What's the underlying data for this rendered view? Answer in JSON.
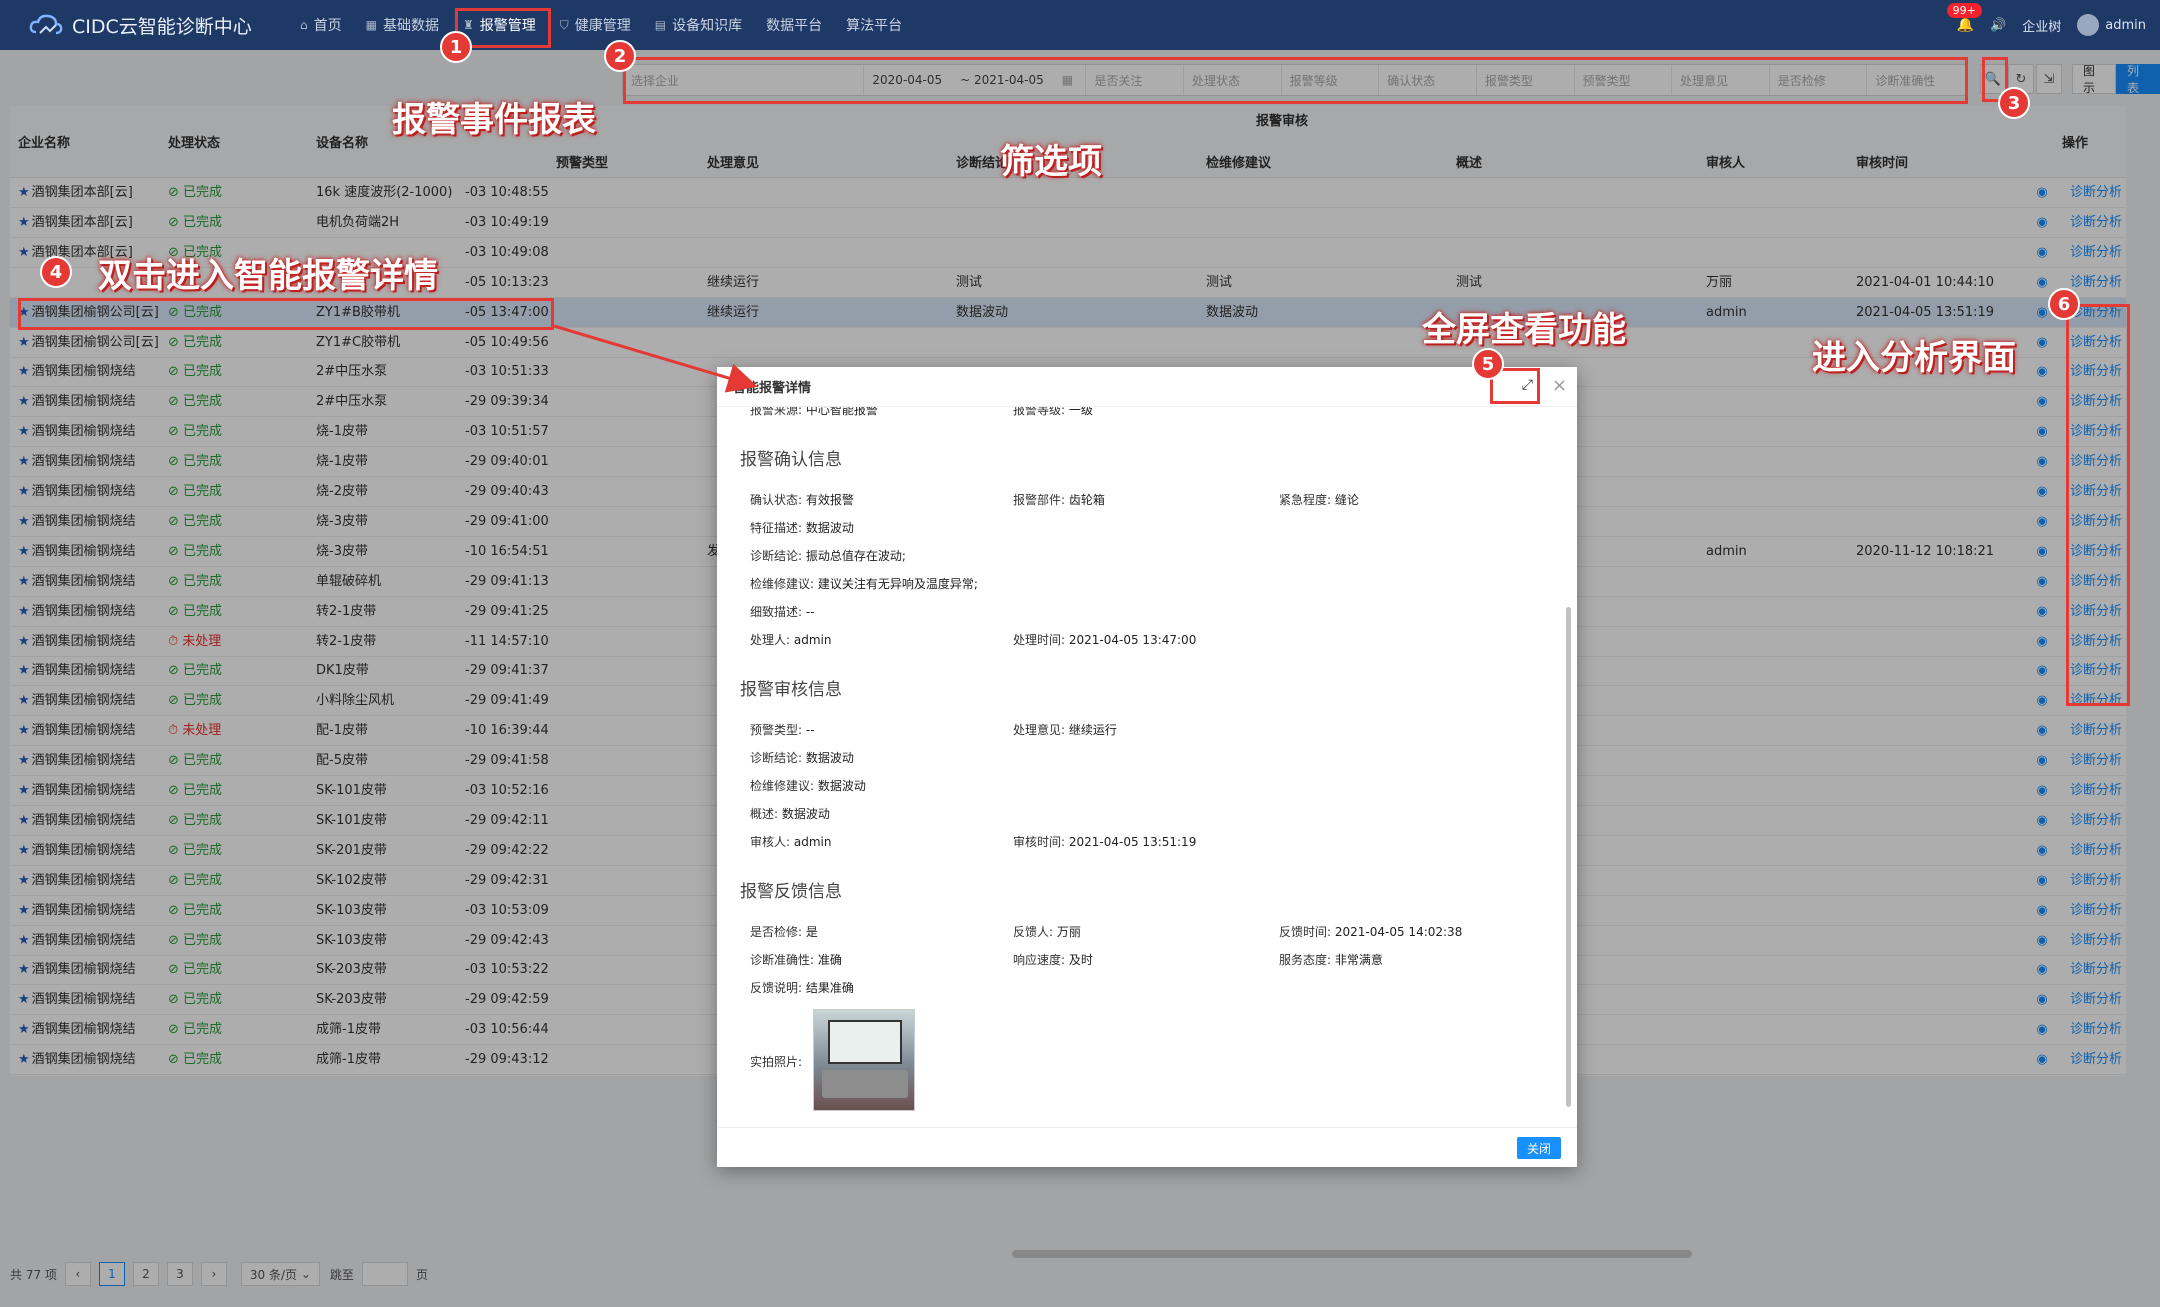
{
  "app": {
    "title": "CIDC云智能诊断中心"
  },
  "nav": [
    {
      "icon": "home-icon",
      "glyph": "⌂",
      "label": "首页",
      "active": false
    },
    {
      "icon": "grid-icon",
      "glyph": "▦",
      "label": "基础数据",
      "active": false
    },
    {
      "icon": "alarm-icon",
      "glyph": "♜",
      "label": "报警管理",
      "active": true
    },
    {
      "icon": "shield-icon",
      "glyph": "⛉",
      "label": "健康管理",
      "active": false
    },
    {
      "icon": "book-icon",
      "glyph": "▤",
      "label": "设备知识库",
      "active": false
    },
    {
      "label": "数据平台",
      "active": false
    },
    {
      "label": "算法平台",
      "active": false
    }
  ],
  "topright": {
    "badge": "99+",
    "enterprise": "企业树",
    "user": "admin"
  },
  "filters": {
    "company": "选择企业",
    "date_start": "2020-04-05",
    "date_end": "~ 2021-04-05",
    "f1": "是否关注",
    "f2": "处理状态",
    "f3": "报警等级",
    "f4": "确认状态",
    "f5": "报警类型",
    "f6": "预警类型",
    "f7": "处理意见",
    "f8": "是否检修",
    "f9": "诊断准确性"
  },
  "views": {
    "chart": "图示",
    "list": "列表"
  },
  "table": {
    "group_header": "报警审核",
    "headers": {
      "company": "企业名称",
      "status": "处理状态",
      "device": "设备名称",
      "warn_type": "预警类型",
      "opinion": "处理意见",
      "diag": "诊断结论",
      "repair": "检维修建议",
      "desc": "概述",
      "auditor": "审核人",
      "audit_time": "审核时间",
      "ops": "操作"
    },
    "link_label": "诊断分析",
    "rows": [
      {
        "company": "酒钢集团本部[云]",
        "status": "已完成",
        "ok": true,
        "device": "16k 速度波形(2-1000)",
        "time": "-03 10:48:55",
        "opinion": "",
        "diag": "",
        "repair": "",
        "desc": "",
        "auditor": "",
        "atime": ""
      },
      {
        "company": "酒钢集团本部[云]",
        "status": "已完成",
        "ok": true,
        "device": "电机负荷端2H",
        "time": "-03 10:49:19",
        "opinion": "",
        "diag": "",
        "repair": "",
        "desc": "",
        "auditor": "",
        "atime": ""
      },
      {
        "company": "酒钢集团本部[云]",
        "status": "已完成",
        "ok": true,
        "device": "",
        "time": "-03 10:49:08",
        "opinion": "",
        "diag": "",
        "repair": "",
        "desc": "",
        "auditor": "",
        "atime": ""
      },
      {
        "company": "",
        "status": "",
        "ok": true,
        "device": "",
        "time": "-05 10:13:23",
        "opinion": "继续运行",
        "diag": "测试",
        "repair": "测试",
        "desc": "测试",
        "auditor": "万丽",
        "atime": "2021-04-01 10:44:10"
      },
      {
        "company": "酒钢集团榆钢公司[云]",
        "status": "已完成",
        "ok": true,
        "device": "ZY1#B胶带机",
        "time": "-05 13:47:00",
        "opinion": "继续运行",
        "diag": "数据波动",
        "repair": "数据波动",
        "desc": "",
        "auditor": "admin",
        "atime": "2021-04-05 13:51:19",
        "selected": true
      },
      {
        "company": "酒钢集团榆钢公司[云]",
        "status": "已完成",
        "ok": true,
        "device": "ZY1#C胶带机",
        "time": "-05 10:49:56",
        "opinion": "",
        "diag": "",
        "repair": "",
        "desc": "",
        "auditor": "",
        "atime": ""
      },
      {
        "company": "酒钢集团榆钢烧结",
        "status": "已完成",
        "ok": true,
        "device": "2#中压水泵",
        "time": "-03 10:51:33",
        "opinion": "",
        "diag": "",
        "repair": "",
        "desc": "",
        "auditor": "",
        "atime": ""
      },
      {
        "company": "酒钢集团榆钢烧结",
        "status": "已完成",
        "ok": true,
        "device": "2#中压水泵",
        "time": "-29 09:39:34",
        "opinion": "",
        "diag": "",
        "repair": "",
        "desc": "",
        "auditor": "",
        "atime": ""
      },
      {
        "company": "酒钢集团榆钢烧结",
        "status": "已完成",
        "ok": true,
        "device": "烧-1皮带",
        "time": "-03 10:51:57",
        "opinion": "",
        "diag": "",
        "repair": "",
        "desc": "",
        "auditor": "",
        "atime": ""
      },
      {
        "company": "酒钢集团榆钢烧结",
        "status": "已完成",
        "ok": true,
        "device": "烧-1皮带",
        "time": "-29 09:40:01",
        "opinion": "",
        "diag": "",
        "repair": "",
        "desc": "",
        "auditor": "",
        "atime": ""
      },
      {
        "company": "酒钢集团榆钢烧结",
        "status": "已完成",
        "ok": true,
        "device": "烧-2皮带",
        "time": "-29 09:40:43",
        "opinion": "",
        "diag": "",
        "repair": "",
        "desc": "",
        "auditor": "",
        "atime": ""
      },
      {
        "company": "酒钢集团榆钢烧结",
        "status": "已完成",
        "ok": true,
        "device": "烧-3皮带",
        "time": "-29 09:41:00",
        "opinion": "",
        "diag": "",
        "repair": "",
        "desc": "",
        "auditor": "",
        "atime": ""
      },
      {
        "company": "酒钢集团榆钢烧结",
        "status": "已完成",
        "ok": true,
        "device": "烧-3皮带",
        "time": "-10 16:54:51",
        "opinion": "发",
        "diag": "",
        "repair": "",
        "desc": "",
        "auditor": "admin",
        "atime": "2020-11-12 10:18:21"
      },
      {
        "company": "酒钢集团榆钢烧结",
        "status": "已完成",
        "ok": true,
        "device": "单辊破碎机",
        "time": "-29 09:41:13",
        "opinion": "",
        "diag": "",
        "repair": "",
        "desc": "",
        "auditor": "",
        "atime": ""
      },
      {
        "company": "酒钢集团榆钢烧结",
        "status": "已完成",
        "ok": true,
        "device": "转2-1皮带",
        "time": "-29 09:41:25",
        "opinion": "",
        "diag": "",
        "repair": "",
        "desc": "",
        "auditor": "",
        "atime": ""
      },
      {
        "company": "酒钢集团榆钢烧结",
        "status": "未处理",
        "ok": false,
        "device": "转2-1皮带",
        "time": "-11 14:57:10",
        "opinion": "",
        "diag": "",
        "repair": "",
        "desc": "",
        "auditor": "",
        "atime": ""
      },
      {
        "company": "酒钢集团榆钢烧结",
        "status": "已完成",
        "ok": true,
        "device": "DK1皮带",
        "time": "-29 09:41:37",
        "opinion": "",
        "diag": "",
        "repair": "",
        "desc": "",
        "auditor": "",
        "atime": ""
      },
      {
        "company": "酒钢集团榆钢烧结",
        "status": "已完成",
        "ok": true,
        "device": "小料除尘风机",
        "time": "-29 09:41:49",
        "opinion": "",
        "diag": "",
        "repair": "",
        "desc": "",
        "auditor": "",
        "atime": ""
      },
      {
        "company": "酒钢集团榆钢烧结",
        "status": "未处理",
        "ok": false,
        "device": "配-1皮带",
        "time": "-10 16:39:44",
        "opinion": "",
        "diag": "",
        "repair": "",
        "desc": "",
        "auditor": "",
        "atime": ""
      },
      {
        "company": "酒钢集团榆钢烧结",
        "status": "已完成",
        "ok": true,
        "device": "配-5皮带",
        "time": "-29 09:41:58",
        "opinion": "",
        "diag": "",
        "repair": "",
        "desc": "",
        "auditor": "",
        "atime": ""
      },
      {
        "company": "酒钢集团榆钢烧结",
        "status": "已完成",
        "ok": true,
        "device": "SK-101皮带",
        "time": "-03 10:52:16",
        "opinion": "",
        "diag": "",
        "repair": "",
        "desc": "",
        "auditor": "",
        "atime": ""
      },
      {
        "company": "酒钢集团榆钢烧结",
        "status": "已完成",
        "ok": true,
        "device": "SK-101皮带",
        "time": "-29 09:42:11",
        "opinion": "",
        "diag": "",
        "repair": "",
        "desc": "",
        "auditor": "",
        "atime": ""
      },
      {
        "company": "酒钢集团榆钢烧结",
        "status": "已完成",
        "ok": true,
        "device": "SK-201皮带",
        "time": "-29 09:42:22",
        "opinion": "",
        "diag": "",
        "repair": "",
        "desc": "",
        "auditor": "",
        "atime": ""
      },
      {
        "company": "酒钢集团榆钢烧结",
        "status": "已完成",
        "ok": true,
        "device": "SK-102皮带",
        "time": "-29 09:42:31",
        "opinion": "",
        "diag": "",
        "repair": "",
        "desc": "",
        "auditor": "",
        "atime": ""
      },
      {
        "company": "酒钢集团榆钢烧结",
        "status": "已完成",
        "ok": true,
        "device": "SK-103皮带",
        "time": "-03 10:53:09",
        "opinion": "",
        "diag": "",
        "repair": "",
        "desc": "",
        "auditor": "",
        "atime": ""
      },
      {
        "company": "酒钢集团榆钢烧结",
        "status": "已完成",
        "ok": true,
        "device": "SK-103皮带",
        "time": "-29 09:42:43",
        "opinion": "",
        "diag": "",
        "repair": "",
        "desc": "",
        "auditor": "",
        "atime": ""
      },
      {
        "company": "酒钢集团榆钢烧结",
        "status": "已完成",
        "ok": true,
        "device": "SK-203皮带",
        "time": "-03 10:53:22",
        "opinion": "",
        "diag": "",
        "repair": "",
        "desc": "",
        "auditor": "",
        "atime": ""
      },
      {
        "company": "酒钢集团榆钢烧结",
        "status": "已完成",
        "ok": true,
        "device": "SK-203皮带",
        "time": "-29 09:42:59",
        "opinion": "",
        "diag": "",
        "repair": "",
        "desc": "",
        "auditor": "",
        "atime": ""
      },
      {
        "company": "酒钢集团榆钢烧结",
        "status": "已完成",
        "ok": true,
        "device": "成筛-1皮带",
        "time": "-03 10:56:44",
        "opinion": "",
        "diag": "",
        "repair": "",
        "desc": "",
        "auditor": "",
        "atime": ""
      },
      {
        "company": "酒钢集团榆钢烧结",
        "status": "已完成",
        "ok": true,
        "device": "成筛-1皮带",
        "time": "-29 09:43:12",
        "opinion": "",
        "diag": "",
        "repair": "",
        "desc": "",
        "auditor": "",
        "atime": ""
      }
    ]
  },
  "pager": {
    "total": "共 77 项",
    "pages": [
      "1",
      "2",
      "3"
    ],
    "page_size": "30 条/页",
    "jump": "跳至",
    "page_unit": "页"
  },
  "modal": {
    "title": "智能报警详情",
    "top_partial": {
      "source_label": "报警来源:",
      "source_value": "中心智能报警",
      "level_label": "报警等级:",
      "level_value": "一级"
    },
    "confirm": {
      "title": "报警确认信息",
      "state_label": "确认状态:",
      "state": "有效报警",
      "part_label": "报警部件:",
      "part": "齿轮箱",
      "urgency_label": "紧急程度:",
      "urgency": "缝论",
      "feature_label": "特征描述:",
      "feature": "数据波动",
      "diag_label": "诊断结论:",
      "diag": "振动总值存在波动;",
      "repair_label": "检维修建议:",
      "repair": "建议关注有无异响及温度异常;",
      "detail_label": "细致描述:",
      "detail": "--",
      "handler_label": "处理人:",
      "handler": "admin",
      "htime_label": "处理时间:",
      "htime": "2021-04-05 13:47:00"
    },
    "audit": {
      "title": "报警审核信息",
      "warn_label": "预警类型:",
      "warn": "--",
      "opinion_label": "处理意见:",
      "opinion": "继续运行",
      "diag_label": "诊断结论:",
      "diag": "数据波动",
      "repair_label": "检维修建议:",
      "repair": "数据波动",
      "desc_label": "概述:",
      "desc": "数据波动",
      "auditor_label": "审核人:",
      "auditor": "admin",
      "atime_label": "审核时间:",
      "atime": "2021-04-05 13:51:19"
    },
    "feedback": {
      "title": "报警反馈信息",
      "repair_label": "是否检修:",
      "repair": "是",
      "person_label": "反馈人:",
      "person": "万丽",
      "ftime_label": "反馈时间:",
      "ftime": "2021-04-05 14:02:38",
      "accuracy_label": "诊断准确性:",
      "accuracy": "准确",
      "speed_label": "响应速度:",
      "speed": "及时",
      "service_label": "服务态度:",
      "service": "非常满意",
      "note_label": "反馈说明:",
      "note": "结果准确",
      "photo_label": "实拍照片:"
    },
    "close_button": "关闭"
  },
  "annotations": {
    "a1": "1",
    "a2": "2",
    "a3": "3",
    "a4": "4",
    "a5": "5",
    "a6": "6",
    "t_report": "报警事件报表",
    "t_filter": "筛选项",
    "t_dblclick": "双击进入智能报警详情",
    "t_fullscreen": "全屏查看功能",
    "t_analysis": "进入分析界面",
    "color": "#e53935"
  }
}
